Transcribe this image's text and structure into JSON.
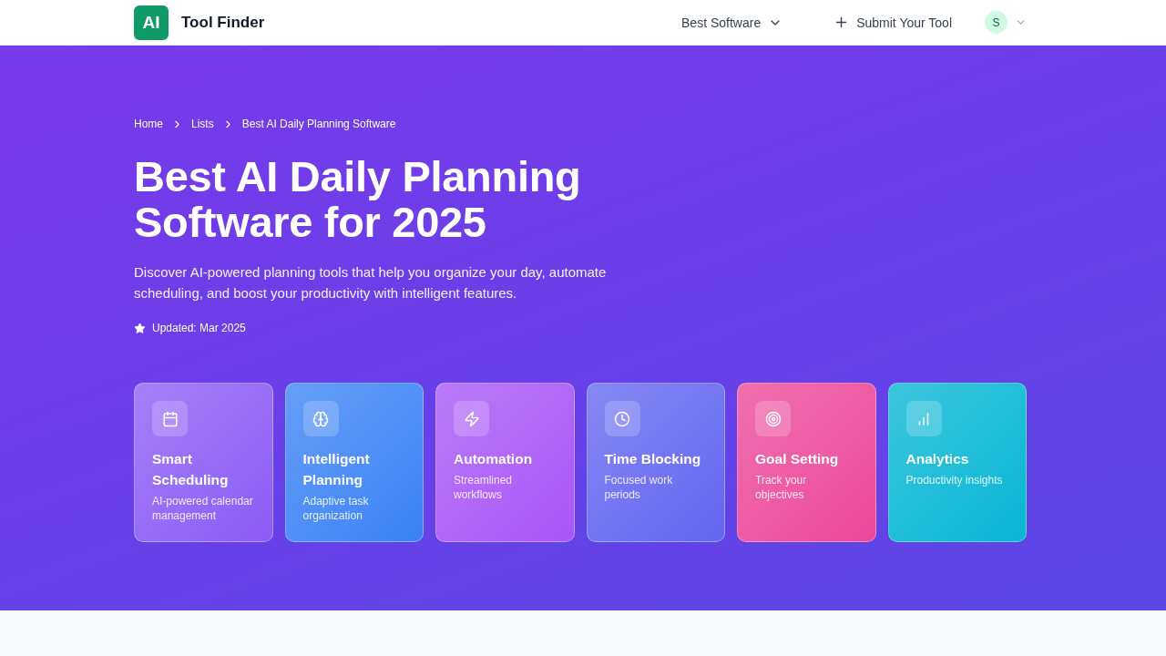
{
  "header": {
    "logo": "AI",
    "brand": "Tool Finder",
    "nav": [
      {
        "label": "Best Software",
        "kind": "dropdown"
      },
      {
        "label": "Submit Your Tool",
        "kind": "action"
      }
    ],
    "avatar": "S"
  },
  "breadcrumb": [
    "Home",
    "Lists",
    "Best AI Daily Planning Software"
  ],
  "hero": {
    "title": "Best AI Daily Planning Software for 2025",
    "description": "Discover AI-powered planning tools that help you organize your day, automate scheduling, and boost your productivity with intelligent features.",
    "updated": "Updated: Mar 2025"
  },
  "features": [
    {
      "title": "Smart Scheduling",
      "description": "AI-powered calendar management",
      "color": "#8b5cf6"
    },
    {
      "title": "Intelligent Planning",
      "description": "Adaptive task organization",
      "color": "#3b82f6"
    },
    {
      "title": "Automation",
      "description": "Streamlined workflows",
      "color": "#a855f7"
    },
    {
      "title": "Time Blocking",
      "description": "Focused work periods",
      "color": "#6366f1"
    },
    {
      "title": "Goal Setting",
      "description": "Track your objectives",
      "color": "#ec4899"
    },
    {
      "title": "Analytics",
      "description": "Productivity insights",
      "color": "#06b6d4"
    }
  ]
}
